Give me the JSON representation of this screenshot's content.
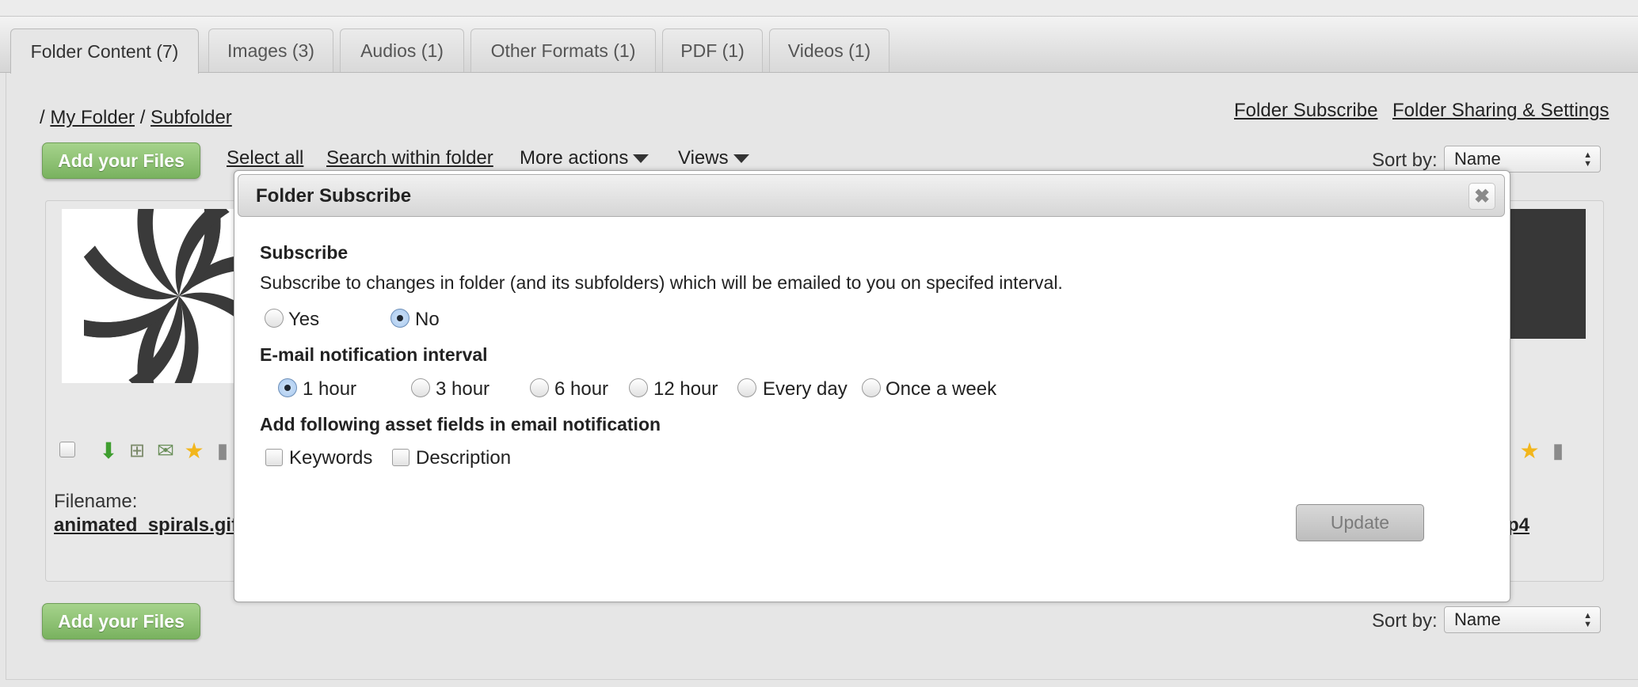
{
  "tabs": [
    {
      "label": "Folder Content (7)",
      "active": true
    },
    {
      "label": "Images (3)",
      "active": false
    },
    {
      "label": "Audios (1)",
      "active": false
    },
    {
      "label": "Other Formats (1)",
      "active": false
    },
    {
      "label": "PDF (1)",
      "active": false
    },
    {
      "label": "Videos (1)",
      "active": false
    }
  ],
  "breadcrumb": {
    "root": "/",
    "folder": "My Folder",
    "separator": "/",
    "subfolder": "Subfolder"
  },
  "header_links": {
    "subscribe": "Folder Subscribe",
    "sharing": "Folder Sharing & Settings"
  },
  "toolbar": {
    "add_files": "Add your Files",
    "select_all": "Select all",
    "search_within": "Search within folder",
    "more_actions": "More actions",
    "views": "Views",
    "sort_label": "Sort by:",
    "sort_value": "Name"
  },
  "files": [
    {
      "filename_label": "Filename:",
      "filename": "animated_spirals.gif"
    },
    {
      "filename_tail": "p4"
    }
  ],
  "footer": {
    "add_files": "Add your Files",
    "sort_label": "Sort by:",
    "sort_value": "Name"
  },
  "modal": {
    "title": "Folder Subscribe",
    "close_symbol": "✖",
    "subscribe_heading": "Subscribe",
    "subscribe_desc": "Subscribe to changes in folder (and its subfolders) which will be emailed to you on specifed interval.",
    "subscribe_options": [
      {
        "label": "Yes",
        "checked": false
      },
      {
        "label": "No",
        "checked": true
      }
    ],
    "interval_heading": "E-mail notification interval",
    "interval_options": [
      {
        "label": "1 hour",
        "checked": true
      },
      {
        "label": "3 hour",
        "checked": false
      },
      {
        "label": "6 hour",
        "checked": false
      },
      {
        "label": "12 hour",
        "checked": false
      },
      {
        "label": "Every day",
        "checked": false
      },
      {
        "label": "Once a week",
        "checked": false
      }
    ],
    "fields_heading": "Add following asset fields in email notification",
    "field_options": [
      {
        "label": "Keywords",
        "checked": false
      },
      {
        "label": "Description",
        "checked": false
      }
    ],
    "update_label": "Update"
  },
  "icons": [
    "download-icon",
    "basket-icon",
    "email-add-icon",
    "star-icon",
    "trash-icon"
  ],
  "colors": {
    "green_button": "#79b25f",
    "thumb_dark": "#373737"
  }
}
